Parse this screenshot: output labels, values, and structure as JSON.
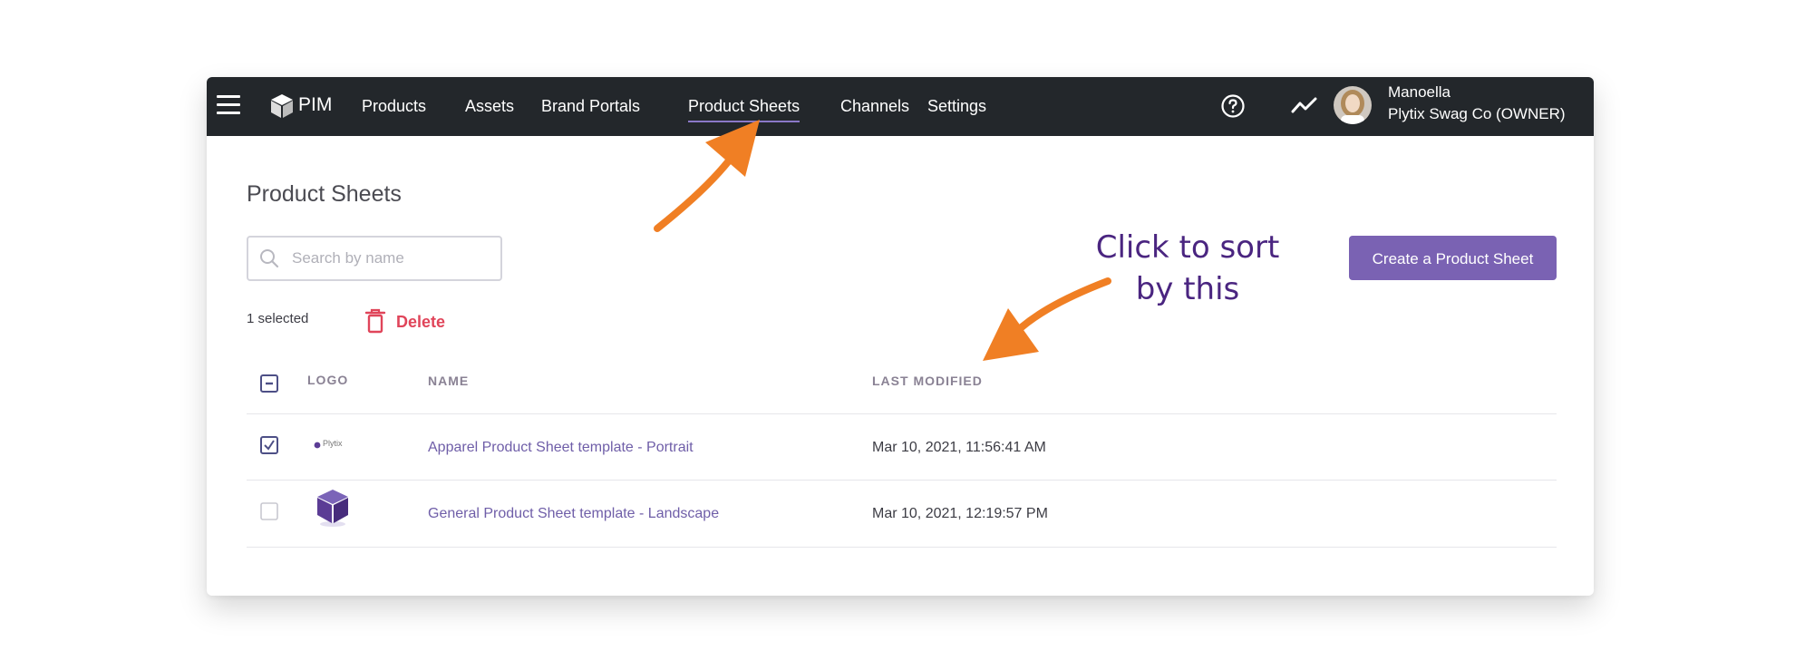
{
  "nav": {
    "brand": "PIM",
    "items": [
      {
        "label": "Products",
        "active": false
      },
      {
        "label": "Assets",
        "active": false
      },
      {
        "label": "Brand Portals",
        "active": false
      },
      {
        "label": "Product Sheets",
        "active": true
      },
      {
        "label": "Channels",
        "active": false
      },
      {
        "label": "Settings",
        "active": false
      }
    ],
    "user": {
      "name": "Manoella",
      "org": "Plytix Swag Co (OWNER)"
    },
    "icons": [
      "menu-icon",
      "cube-icon",
      "help-icon",
      "trend-icon"
    ]
  },
  "page": {
    "title": "Product Sheets",
    "search_placeholder": "Search by name",
    "create_button": "Create a Product Sheet",
    "selected_count": "1 selected",
    "delete_label": "Delete"
  },
  "table": {
    "columns": [
      "LOGO",
      "NAME",
      "LAST MODIFIED"
    ],
    "header_checkbox": "indeterminate",
    "rows": [
      {
        "checked": true,
        "logo": "Plytix",
        "name": "Apparel Product Sheet template - Portrait",
        "last_modified": "Mar 10, 2021, 11:56:41 AM"
      },
      {
        "checked": false,
        "logo": "cube",
        "name": "General Product Sheet template - Landscape",
        "last_modified": "Mar 10, 2021, 12:19:57 PM"
      }
    ]
  },
  "annotation": {
    "line1": "Click to sort",
    "line2": "by this"
  },
  "colors": {
    "topbar": "#23272b",
    "accent": "#7a62b3",
    "link": "#6f5ea8",
    "danger": "#e0455a",
    "arrow": "#f07f24",
    "annotation_text": "#4a2580"
  }
}
